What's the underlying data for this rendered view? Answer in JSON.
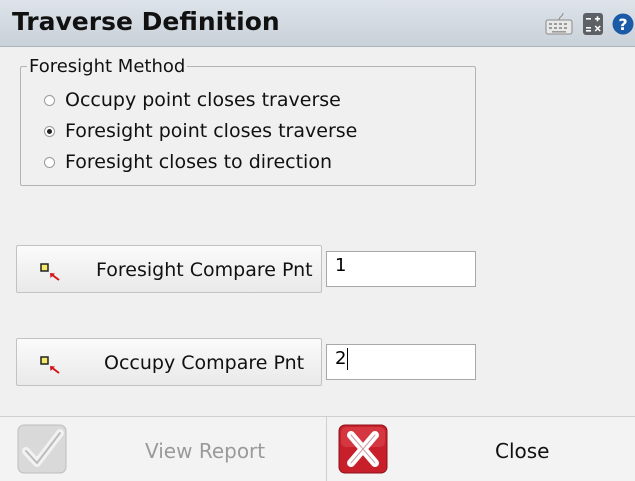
{
  "window": {
    "title": "Traverse Definition",
    "icons": [
      "keyboard-icon",
      "calculator-icon",
      "help-icon"
    ],
    "help_glyph": "?"
  },
  "foresight_method": {
    "legend": "Foresight Method",
    "options": [
      {
        "label": "Occupy point closes traverse",
        "selected": false
      },
      {
        "label": "Foresight point closes traverse",
        "selected": true
      },
      {
        "label": "Foresight closes to direction",
        "selected": false
      }
    ]
  },
  "foresight_compare": {
    "button_label": "Foresight Compare Pnt",
    "value": "1"
  },
  "occupy_compare": {
    "button_label": "Occupy Compare Pnt",
    "value": "2"
  },
  "bottom": {
    "view_report_label": "View Report",
    "view_report_enabled": false,
    "close_label": "Close"
  },
  "colors": {
    "titlebar": "#c9d1d9",
    "help_blue": "#1a5aa6",
    "close_red": "#c8202a",
    "disabled_text": "#9a9a9a"
  }
}
